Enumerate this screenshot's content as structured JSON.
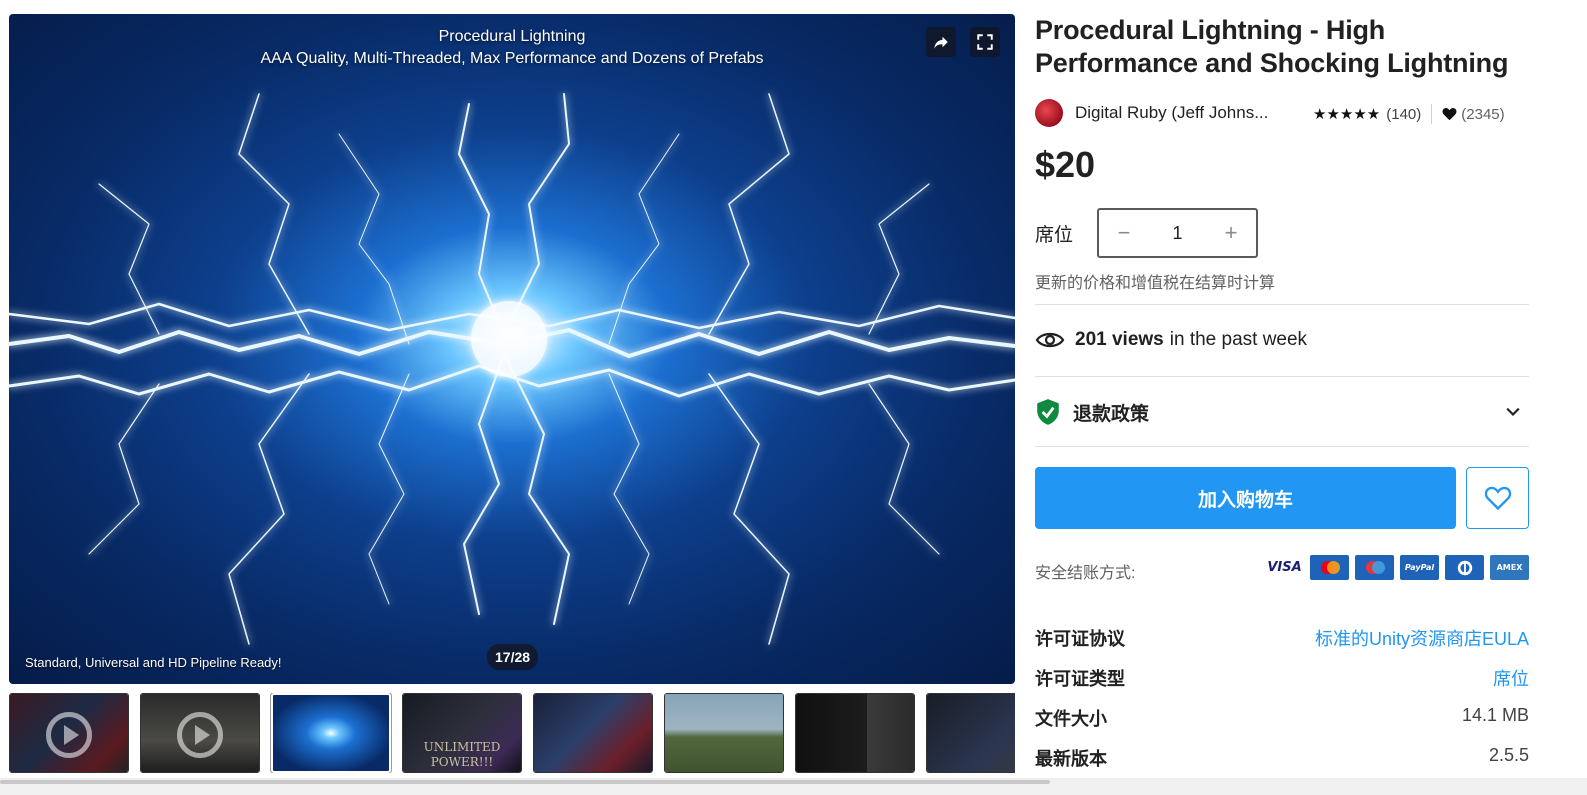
{
  "gallery": {
    "caption_line1": "Procedural Lightning",
    "caption_line2": "AAA Quality, Multi-Threaded, Max Performance and Dozens of Prefabs",
    "bottom_text": "Standard, Universal and HD Pipeline Ready!",
    "counter": "17/28",
    "share_icon": "share-arrow-icon",
    "fullscreen_icon": "fullscreen-icon",
    "thumbnails": [
      {
        "kind": "video",
        "label": ""
      },
      {
        "kind": "video",
        "label": ""
      },
      {
        "kind": "image",
        "label": ""
      },
      {
        "kind": "image",
        "label_line1": "UNLIMITED",
        "label_line2": "POWER!!!"
      },
      {
        "kind": "image",
        "label": ""
      },
      {
        "kind": "image",
        "label": ""
      },
      {
        "kind": "image",
        "label": ""
      },
      {
        "kind": "image",
        "label": ""
      }
    ]
  },
  "product": {
    "title": "Procedural Lightning - High Performance and Shocking Lightning",
    "publisher": "Digital Ruby (Jeff Johns...",
    "stars": "★★★★★",
    "rating_count": "(140)",
    "favorites_count": "(2345)",
    "price": "$20",
    "seat_label": "席位",
    "quantity": "1",
    "minus": "−",
    "plus": "+",
    "vat_note": "更新的价格和增值税在结算时计算",
    "views_number": "201 views",
    "views_suffix": "in the past week",
    "refund_label": "退款政策",
    "add_to_cart": "加入购物车",
    "payment_label": "安全结账方式:",
    "payment_methods": [
      "VISA",
      "Mastercard",
      "Maestro",
      "PayPal",
      "Diners",
      "AMEX"
    ],
    "accent_color": "#2196f3"
  },
  "details": [
    {
      "key": "许可证协议",
      "value": "标准的Unity资源商店EULA",
      "link": true
    },
    {
      "key": "许可证类型",
      "value": "席位",
      "link": true
    },
    {
      "key": "文件大小",
      "value": "14.1 MB",
      "link": false
    },
    {
      "key": "最新版本",
      "value": "2.5.5",
      "link": false
    }
  ]
}
